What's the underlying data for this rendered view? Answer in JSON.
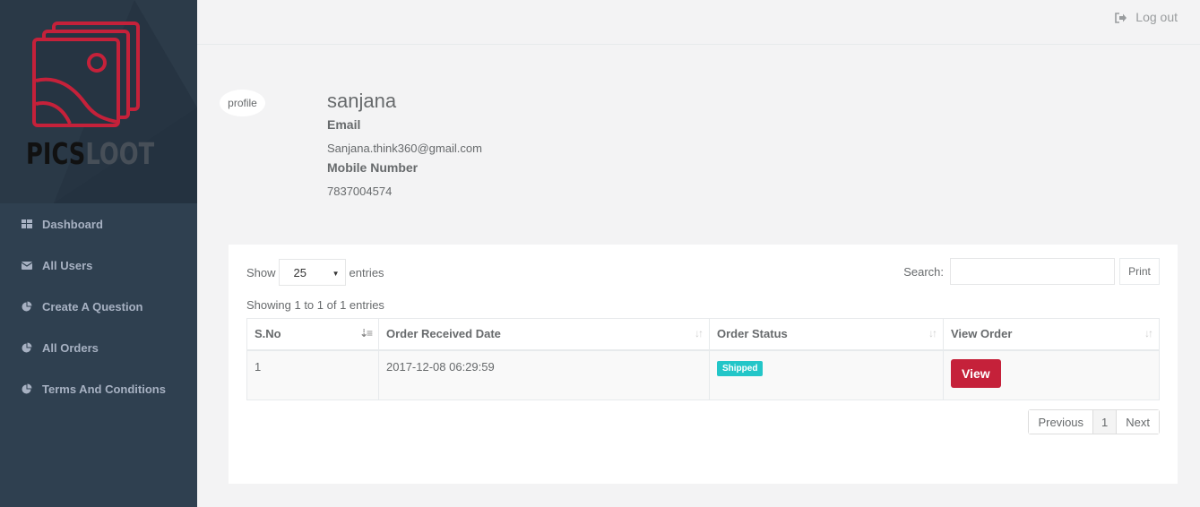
{
  "brand": {
    "part1": "PICS",
    "part2": "LOOT",
    "accent": "#c5213a"
  },
  "sidebar": {
    "items": [
      {
        "label": "Dashboard",
        "icon": "dashboard-icon"
      },
      {
        "label": "All Users",
        "icon": "envelope-icon"
      },
      {
        "label": "Create A Question",
        "icon": "pie-chart-icon"
      },
      {
        "label": "All Orders",
        "icon": "pie-chart-icon"
      },
      {
        "label": "Terms And Conditions",
        "icon": "pie-chart-icon"
      }
    ]
  },
  "topbar": {
    "logout_label": "Log out",
    "logout_icon": "sign-out-icon"
  },
  "profile": {
    "image_alt": "profile",
    "name": "sanjana",
    "email_label": "Email",
    "email": "Sanjana.think360@gmail.com",
    "mobile_label": "Mobile Number",
    "mobile": "7837004574"
  },
  "table_controls": {
    "show_label": "Show",
    "page_size": "25",
    "entries_label": "entries",
    "search_label": "Search:",
    "search_value": "",
    "print_label": "Print",
    "info": "Showing 1 to 1 of 1 entries"
  },
  "orders_table": {
    "columns": [
      "S.No",
      "Order Received Date",
      "Order Status",
      "View Order"
    ],
    "rows": [
      {
        "sno": "1",
        "date": "2017-12-08 06:29:59",
        "status": "Shipped",
        "action": "View"
      }
    ]
  },
  "pagination": {
    "previous": "Previous",
    "current": "1",
    "next": "Next"
  },
  "colors": {
    "sidebar": "#2f4050",
    "status_shipped": "#23c6c8",
    "view_button": "#c5213a"
  }
}
